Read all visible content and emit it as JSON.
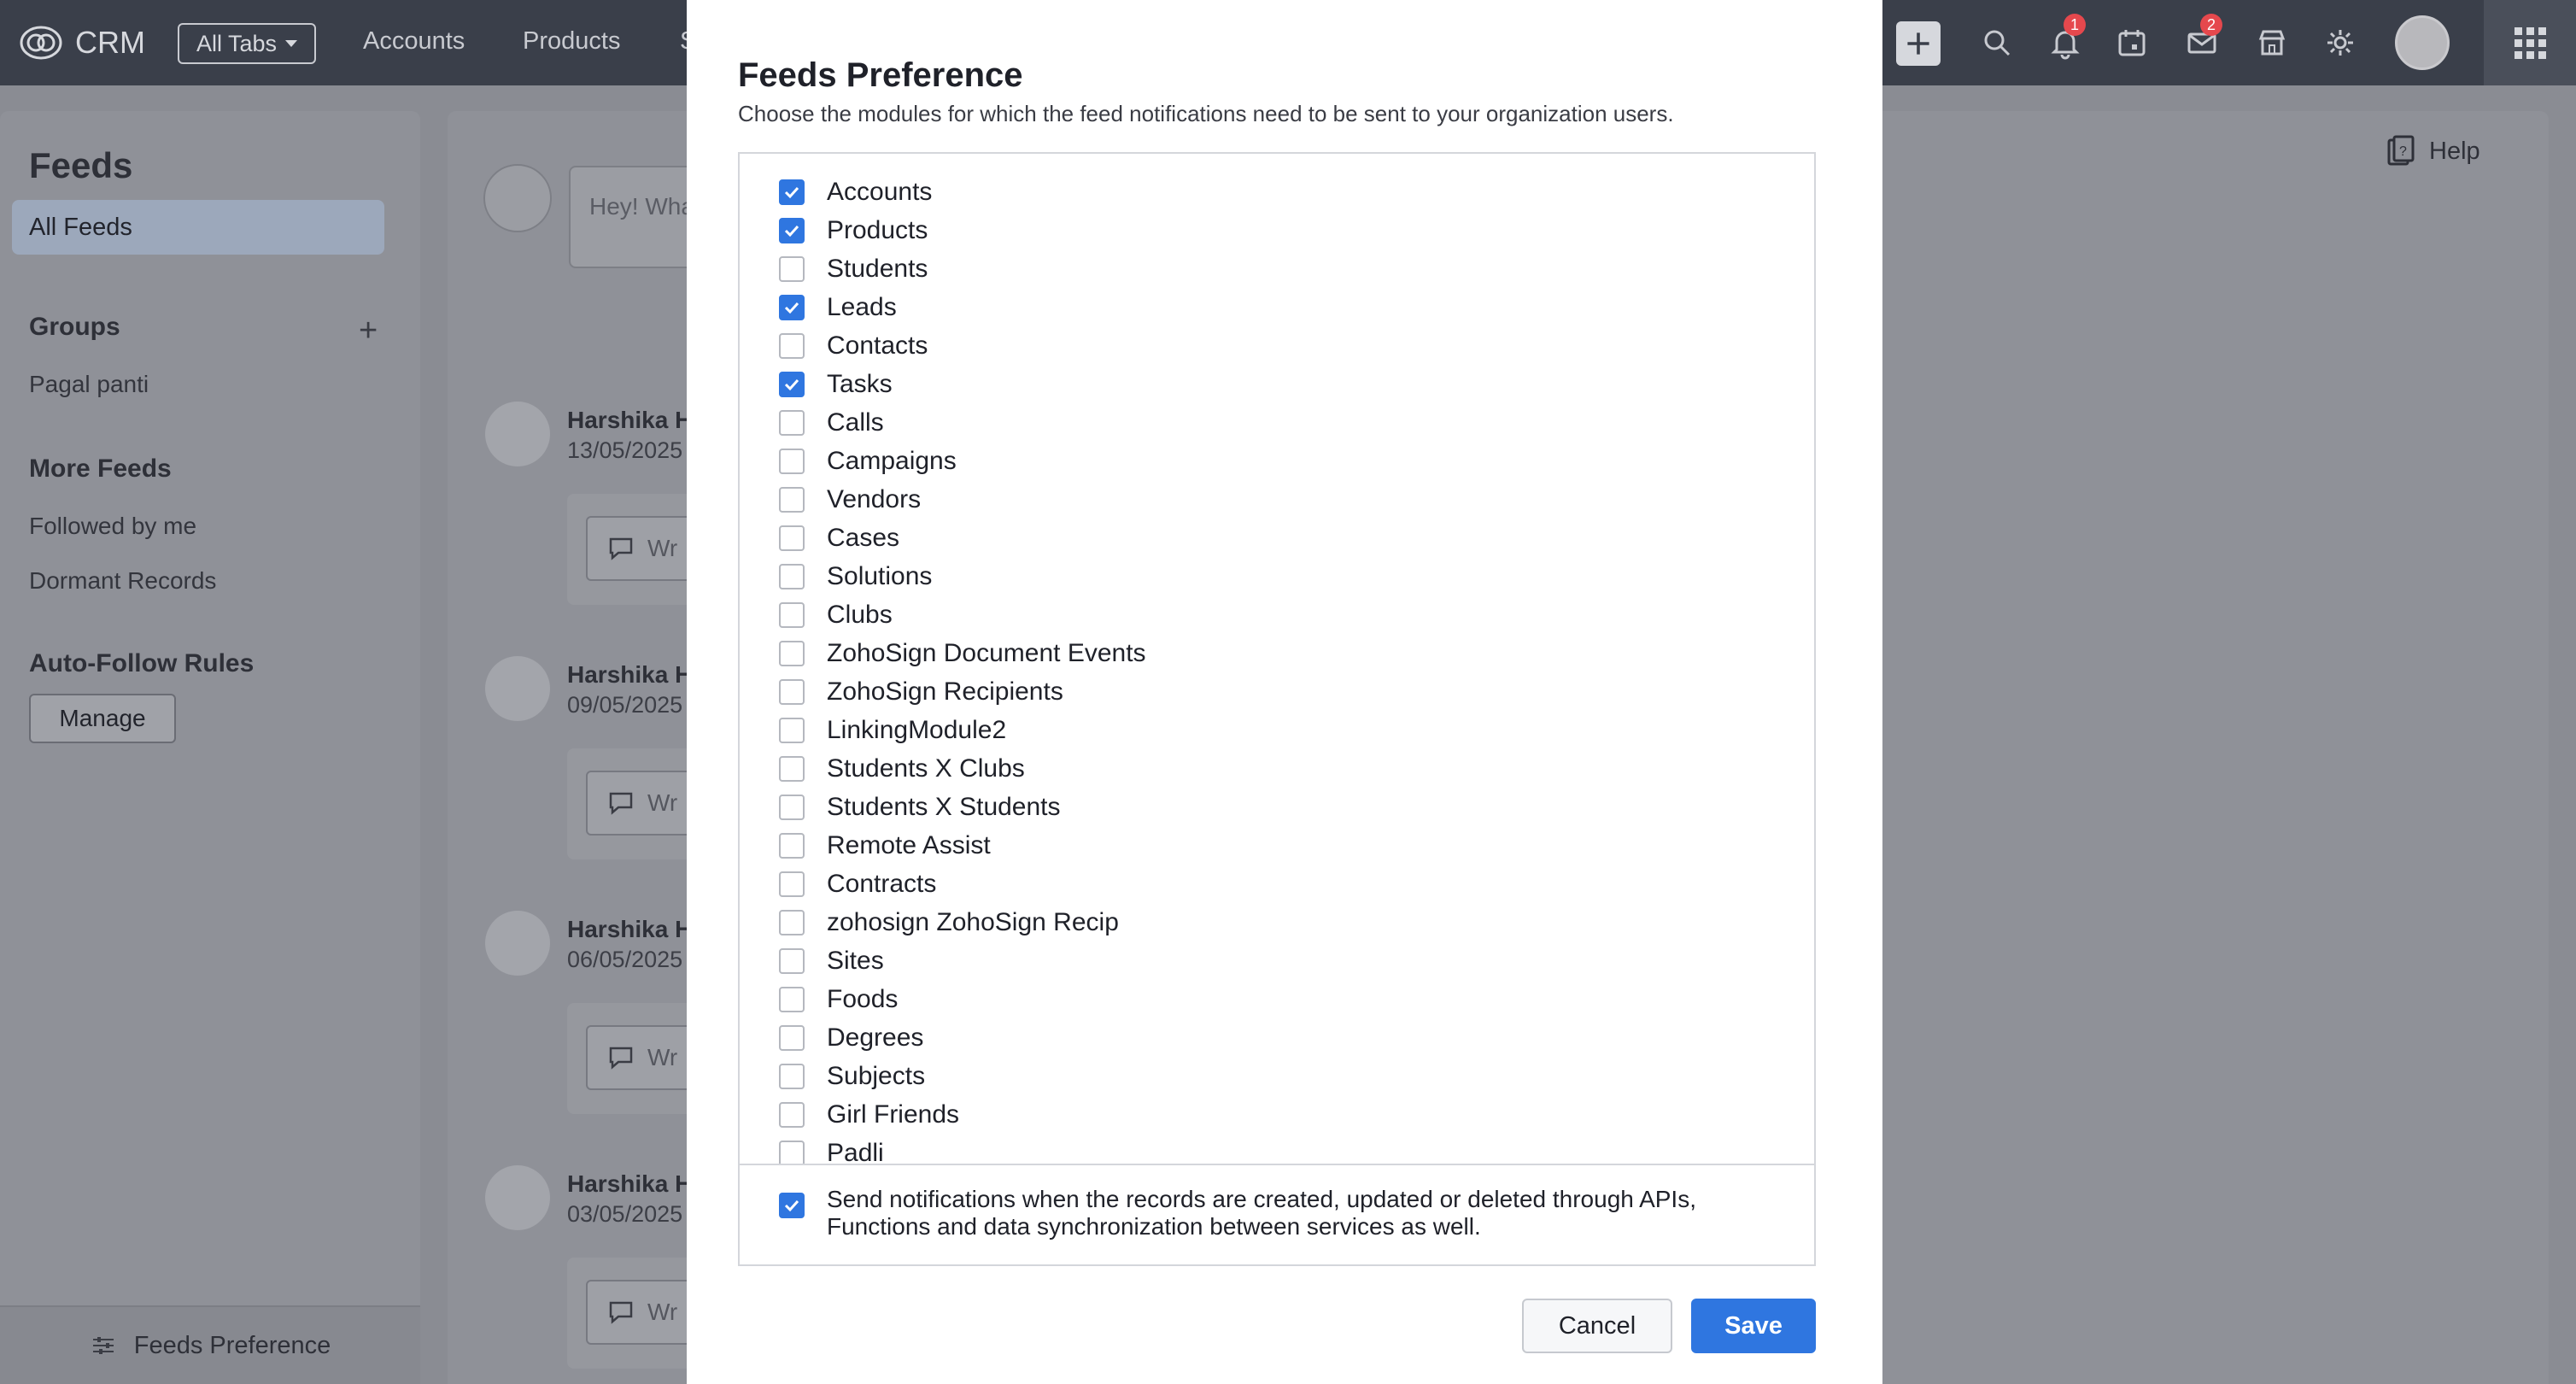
{
  "topbar": {
    "app_name": "CRM",
    "all_tabs_label": "All Tabs",
    "nav_tabs": [
      "Accounts",
      "Products",
      "S"
    ],
    "notification_count": "1",
    "mail_count": "2",
    "icons": [
      "add-icon",
      "search-icon",
      "bell-icon",
      "calendar-icon",
      "mail-icon",
      "marketplace-icon",
      "gear-icon",
      "avatar",
      "apps-grid-icon"
    ]
  },
  "sidebar": {
    "title": "Feeds",
    "active_item": "All Feeds",
    "groups_heading": "Groups",
    "groups": [
      "Pagal panti"
    ],
    "more_feeds_heading": "More Feeds",
    "more_feeds": [
      "Followed by me",
      "Dormant Records"
    ],
    "auto_follow_heading": "Auto-Follow Rules",
    "manage_label": "Manage",
    "footer_label": "Feeds Preference"
  },
  "main": {
    "help_label": "Help",
    "post_placeholder": "Hey! Wha",
    "feeds": [
      {
        "name": "Harshika H",
        "date": "13/05/2025",
        "comment_placeholder": "Wr"
      },
      {
        "name": "Harshika H",
        "date": "09/05/2025",
        "comment_placeholder": "Wr"
      },
      {
        "name": "Harshika H",
        "date": "06/05/2025",
        "comment_placeholder": "Wr"
      },
      {
        "name": "Harshika H",
        "date": "03/05/2025",
        "comment_placeholder": "Wr"
      }
    ]
  },
  "modal": {
    "title": "Feeds Preference",
    "subtitle": "Choose the modules for which the feed notifications need to be sent to your organization users.",
    "modules": [
      {
        "label": "Accounts",
        "checked": true
      },
      {
        "label": "Products",
        "checked": true
      },
      {
        "label": "Students",
        "checked": false
      },
      {
        "label": "Leads",
        "checked": true
      },
      {
        "label": "Contacts",
        "checked": false
      },
      {
        "label": "Tasks",
        "checked": true
      },
      {
        "label": "Calls",
        "checked": false
      },
      {
        "label": "Campaigns",
        "checked": false
      },
      {
        "label": "Vendors",
        "checked": false
      },
      {
        "label": "Cases",
        "checked": false
      },
      {
        "label": "Solutions",
        "checked": false
      },
      {
        "label": "Clubs",
        "checked": false
      },
      {
        "label": "ZohoSign Document Events",
        "checked": false
      },
      {
        "label": "ZohoSign Recipients",
        "checked": false
      },
      {
        "label": "LinkingModule2",
        "checked": false
      },
      {
        "label": "Students X Clubs",
        "checked": false
      },
      {
        "label": "Students X Students",
        "checked": false
      },
      {
        "label": "Remote Assist",
        "checked": false
      },
      {
        "label": "Contracts",
        "checked": false
      },
      {
        "label": "zohosign ZohoSign Recip",
        "checked": false
      },
      {
        "label": "Sites",
        "checked": false
      },
      {
        "label": "Foods",
        "checked": false
      },
      {
        "label": "Degrees",
        "checked": false
      },
      {
        "label": "Subjects",
        "checked": false
      },
      {
        "label": "Girl Friends",
        "checked": false
      },
      {
        "label": "Padli",
        "checked": false
      }
    ],
    "notify_text": "Send notifications when the records are created, updated or deleted through APIs, Functions and data synchronization between services as well.",
    "notify_checked": true,
    "cancel_label": "Cancel",
    "save_label": "Save"
  },
  "colors": {
    "accent": "#2f76e0",
    "topbar": "#3a3f4a",
    "overlay_bg": "#8a8c93",
    "badge": "#e5484d"
  }
}
